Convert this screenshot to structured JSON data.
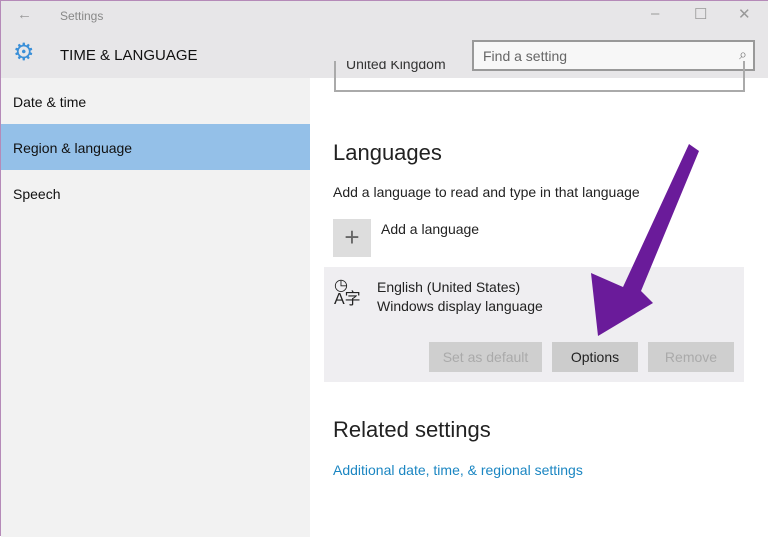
{
  "window": {
    "title": "Settings",
    "back": "←",
    "minimize": "–",
    "maximize": "☐",
    "close": "✕"
  },
  "header": {
    "title": "TIME & LANGUAGE",
    "search_placeholder": "Find a setting"
  },
  "sidebar": {
    "items": [
      {
        "label": "Date & time"
      },
      {
        "label": "Region & language",
        "selected": true
      },
      {
        "label": "Speech"
      }
    ]
  },
  "main": {
    "country_value": "United Kingdom",
    "languages_heading": "Languages",
    "languages_desc": "Add a language to read and type in that language",
    "add_language": "Add a language",
    "language": {
      "name": "English (United States)",
      "subtitle": "Windows display language"
    },
    "buttons": {
      "set_default": "Set as default",
      "options": "Options",
      "remove": "Remove"
    },
    "related_heading": "Related settings",
    "related_link": "Additional date, time, & regional settings"
  },
  "colors": {
    "accent": "#3a8fd8",
    "selected": "#94c0e8",
    "arrow": "#6a1b9a",
    "link": "#1b86c2"
  }
}
